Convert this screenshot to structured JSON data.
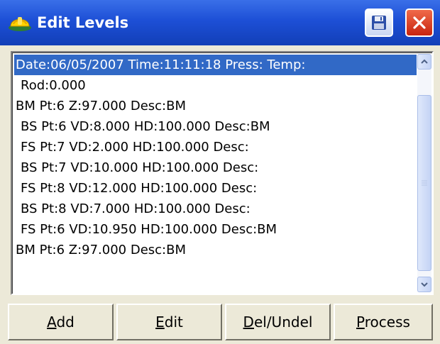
{
  "window": {
    "title": "Edit Levels"
  },
  "list": {
    "rows": [
      "Date:06/05/2007 Time:11:11:18 Press: Temp:",
      "Rod:0.000",
      "BM Pt:6 Z:97.000 Desc:BM",
      "BS Pt:6 VD:8.000 HD:100.000 Desc:BM",
      "FS Pt:7 VD:2.000 HD:100.000 Desc:",
      "BS Pt:7 VD:10.000 HD:100.000 Desc:",
      "FS Pt:8 VD:12.000 HD:100.000 Desc:",
      "BS Pt:8 VD:7.000 HD:100.000 Desc:",
      "FS Pt:6 VD:10.950 HD:100.000 Desc:BM",
      "BM Pt:6 Z:97.000 Desc:BM"
    ],
    "selected_index": 0
  },
  "buttons": {
    "add": {
      "mnemonic": "A",
      "rest": "dd"
    },
    "edit": {
      "mnemonic": "E",
      "rest": "dit"
    },
    "del_undel": {
      "mnemonic": "D",
      "rest": "el/Undel"
    },
    "process": {
      "mnemonic": "P",
      "rest": "rocess"
    }
  },
  "colors": {
    "titlebar": "#1d4fd6",
    "selection": "#3169c6",
    "close": "#c8240e"
  },
  "icons": {
    "app": "hardhat-icon",
    "save": "floppy-disk-icon",
    "close": "close-icon",
    "scroll_up": "chevron-up-icon",
    "scroll_down": "chevron-down-icon"
  }
}
